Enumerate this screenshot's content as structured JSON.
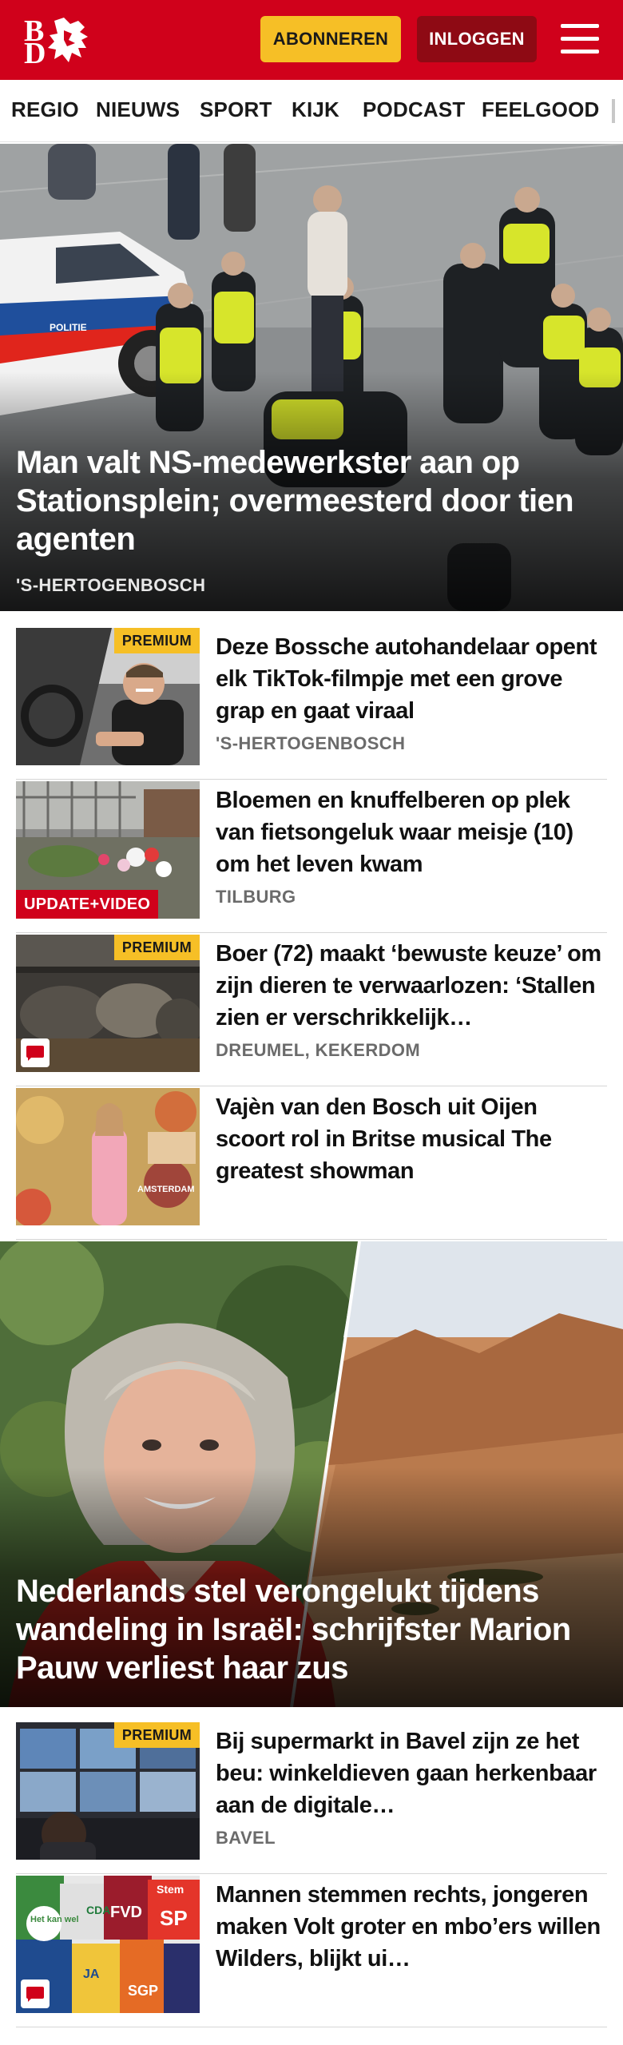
{
  "header": {
    "logo_letters": [
      "B",
      "D"
    ],
    "subscribe_label": "ABONNEREN",
    "login_label": "INLOGGEN",
    "colors": {
      "brand": "#d0011b",
      "subscribe": "#f6bf26",
      "login": "#8e0a14"
    }
  },
  "nav": {
    "items": [
      "REGIO",
      "NIEUWS",
      "SPORT",
      "KIJK",
      "PODCAST",
      "FEELGOOD"
    ]
  },
  "hero1": {
    "title": "Man valt NS-medewerkster aan op Stationsplein; overmeesterd door tien agenten",
    "location": "'S-HERTOGENBOSCH",
    "car_text": "POLITIE"
  },
  "articles1": [
    {
      "title": "Deze Bossche autohandelaar opent elk TikTok-filmpje met een grove grap en gaat viraal",
      "location": "'S-HERTOGENBOSCH",
      "badge": "PREMIUM"
    },
    {
      "title": "Bloemen en knuffelberen op plek van fietsongeluk waar meisje (10) om het leven kwam",
      "location": "TILBURG",
      "badge": "UPDATE+VIDEO"
    },
    {
      "title": "Boer (72) maakt ‘bewuste keuze’ om zijn dieren te verwaarlozen: ‘Stallen zien er verschrikkelijk…",
      "location": "DREUMEL, KEKERDOM",
      "badge": "PREMIUM",
      "comment_icon": "comment-icon"
    },
    {
      "title": "Vajèn van den Bosch uit Oijen scoort rol in Britse musical The greatest showman",
      "location": "",
      "thumb_text": "AMSTERDAM"
    }
  ],
  "hero2": {
    "title": "Nederlands stel verongelukt tijdens wandeling in Israël: schrijfster Marion Pauw verliest haar zus"
  },
  "articles2": [
    {
      "title": "Bij supermarkt in Bavel zijn ze het beu: winkeldieven gaan herkenbaar aan de digitale…",
      "location": "BAVEL",
      "badge": "PREMIUM"
    },
    {
      "title": "Mannen stemmen rechts, jongeren maken Volt groter en mbo’ers willen Wilders, blijkt ui…",
      "location": "",
      "comment_icon": "comment-icon",
      "poster_words": [
        "Het kan wel",
        "CDA",
        "FVD",
        "SP",
        "JA",
        "SGP",
        "Stem"
      ]
    }
  ]
}
